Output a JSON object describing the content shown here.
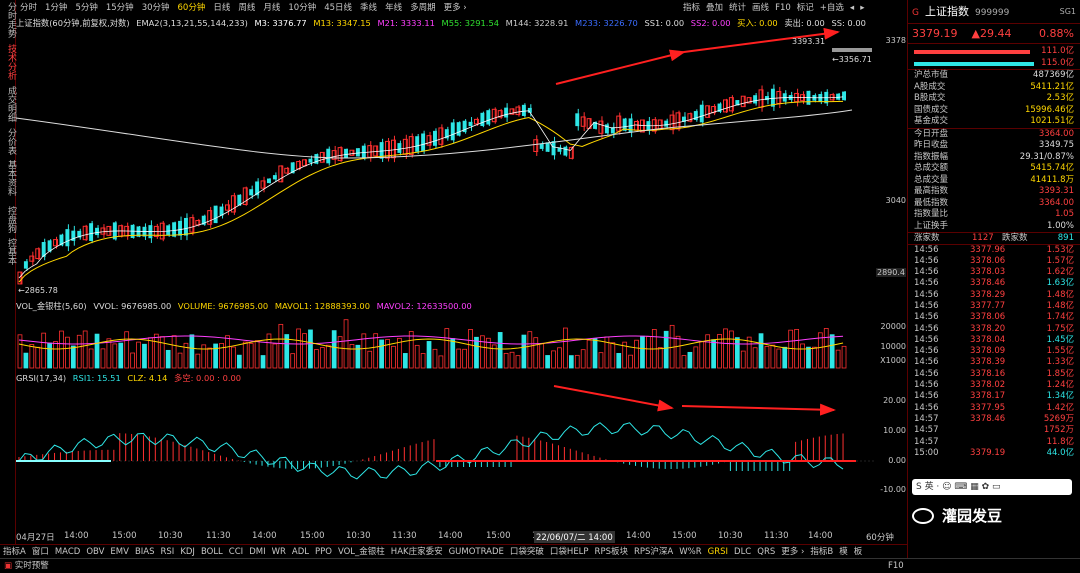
{
  "left_tabs": [
    "分时走势",
    "技术分析",
    "成交明细",
    "分价表",
    "基本资料",
    "控盘狗",
    "控基本"
  ],
  "periods": [
    "分时",
    "1分钟",
    "5分钟",
    "15分钟",
    "30分钟",
    "60分钟",
    "日线",
    "周线",
    "月线",
    "10分钟",
    "45日线",
    "季线",
    "年线",
    "多周期",
    "更多 ›"
  ],
  "active_period": "60分钟",
  "tools": [
    "指标",
    "叠加",
    "统计",
    "画线",
    "F10",
    "标记",
    "+自选",
    "◂",
    "▸"
  ],
  "main_indicator": {
    "name": "上证指数(60分钟,前复权,对数)",
    "ema": "EMA2(3,13,21,55,144,233)",
    "m3": "M3: 3376.77",
    "m13": "M13: 3347.15",
    "m21": "M21: 3333.11",
    "m55": "M55: 3291.54",
    "m144": "M144: 3228.91",
    "m233": "M233: 3226.70",
    "ss1": "SS1: 0.00",
    "ss2": "SS2: 0.00",
    "buy": "买入: 0.00",
    "sell": "卖出: 0.00",
    "ss": "SS: 0.00"
  },
  "price_axis": [
    "3378",
    "3040",
    "2890.4"
  ],
  "annotations": {
    "high": "3393.31",
    "last": "3356.71",
    "low": "2865.78"
  },
  "vol_header": {
    "name": "VOL_金银柱(5,60)",
    "vvol": "VVOL: 9676985.00",
    "volume": "VOLUME: 9676985.00",
    "mavol1": "MAVOL1: 12888393.00",
    "mavol2": "MAVOL2: 12633500.00"
  },
  "vol_axis": [
    "20000",
    "10000",
    "X1000"
  ],
  "grsi_header": {
    "name": "GRSI(17,34)",
    "rsi1": "RSI1: 15.51",
    "clz": "CLZ: 4.14",
    "dk": "多空: 0.00 : 0.00"
  },
  "grsi_axis": [
    "20.00",
    "10.00",
    "0.00",
    "-10.00"
  ],
  "x_axis": [
    "04月27日",
    "14:00",
    "15:00",
    "10:30",
    "11:30",
    "14:00",
    "15:00",
    "10:30",
    "11:30",
    "14:00",
    "15:00",
    "10:30",
    "11:30",
    "14:00",
    "15:00",
    "10:30",
    "11:30",
    "14:00",
    "60分钟"
  ],
  "x_highlight": "22/06/07/二 14:00",
  "bottom_tabs": [
    "指标A",
    "窗口",
    "MACD",
    "OBV",
    "EMV",
    "BIAS",
    "RSI",
    "KDJ",
    "BOLL",
    "CCI",
    "DMI",
    "WR",
    "ADL",
    "PPO",
    "VOL_金银柱",
    "HAK庄家委安",
    "GUMOTRADE",
    "口袋突破",
    "口袋HELP",
    "RPS板块",
    "RPS沪深A",
    "W%R",
    "GRSI",
    "DLC",
    "QRS",
    "更多 ›",
    "指标B",
    "模",
    "板"
  ],
  "active_bottom": "GRSI",
  "status": "实时预警",
  "status_right": "F10",
  "quote": {
    "g": "G",
    "name": "上证指数",
    "code": "999999",
    "sg": "SG1",
    "price": "3379.19",
    "change": "▲29.44",
    "pct": "0.88%"
  },
  "breadth": [
    {
      "v": "111.0亿",
      "color": "#ff4040"
    },
    {
      "v": "115.0亿",
      "color": "#2ee6e6"
    }
  ],
  "stats1": [
    {
      "k": "沪总市值",
      "v": "487369亿",
      "c": "wht"
    },
    {
      "k": "A股成交",
      "v": "5411.21亿",
      "c": "yel"
    },
    {
      "k": "B股成交",
      "v": "2.53亿",
      "c": "yel"
    },
    {
      "k": "国债成交",
      "v": "15996.46亿",
      "c": "yel"
    },
    {
      "k": "基金成交",
      "v": "1021.51亿",
      "c": "yel"
    }
  ],
  "stats2": [
    {
      "k": "今日开盘",
      "v": "3364.00",
      "c": "red"
    },
    {
      "k": "昨日收盘",
      "v": "3349.75",
      "c": "wht"
    },
    {
      "k": "指数振幅",
      "v": "29.31/0.87%",
      "c": "wht"
    },
    {
      "k": "总成交额",
      "v": "5415.74亿",
      "c": "yel"
    },
    {
      "k": "总成交量",
      "v": "41411.8万",
      "c": "yel"
    },
    {
      "k": "最高指数",
      "v": "3393.31",
      "c": "red"
    },
    {
      "k": "最低指数",
      "v": "3364.00",
      "c": "red"
    },
    {
      "k": "指数量比",
      "v": "1.05",
      "c": "red"
    },
    {
      "k": "上证换手",
      "v": "1.00%",
      "c": "wht"
    }
  ],
  "updown": {
    "up_label": "涨家数",
    "up": "1127",
    "down_label": "跌家数",
    "down": "891"
  },
  "ticks": [
    {
      "t": "14:56",
      "p": "3377.96",
      "q": "1.53亿"
    },
    {
      "t": "14:56",
      "p": "3378.06",
      "q": "1.57亿"
    },
    {
      "t": "14:56",
      "p": "3378.03",
      "q": "1.62亿"
    },
    {
      "t": "14:56",
      "p": "3378.46",
      "q": "1.63亿"
    },
    {
      "t": "14:56",
      "p": "3378.29",
      "q": "1.48亿"
    },
    {
      "t": "14:56",
      "p": "3377.77",
      "q": "1.48亿"
    },
    {
      "t": "14:56",
      "p": "3378.06",
      "q": "1.74亿"
    },
    {
      "t": "14:56",
      "p": "3378.20",
      "q": "1.75亿"
    },
    {
      "t": "14:56",
      "p": "3378.04",
      "q": "1.45亿"
    },
    {
      "t": "14:56",
      "p": "3378.09",
      "q": "1.55亿"
    },
    {
      "t": "14:56",
      "p": "3378.39",
      "q": "1.33亿"
    },
    {
      "t": "14:56",
      "p": "3378.16",
      "q": "1.85亿"
    },
    {
      "t": "14:56",
      "p": "3378.02",
      "q": "1.24亿"
    },
    {
      "t": "14:56",
      "p": "3378.17",
      "q": "1.34亿"
    },
    {
      "t": "14:56",
      "p": "3377.95",
      "q": "1.42亿"
    },
    {
      "t": "14:57",
      "p": "3378.46",
      "q": "5269万"
    },
    {
      "t": "14:57",
      "p": "",
      "q": "1752万"
    },
    {
      "t": "14:57",
      "p": "",
      "q": "11.8亿"
    },
    {
      "t": "15:00",
      "p": "3379.19",
      "q": "44.0亿"
    }
  ],
  "ime": "S 英 · ☺ ⌨ ▦ ✿ ▭",
  "watermark": "灌园发豆"
}
